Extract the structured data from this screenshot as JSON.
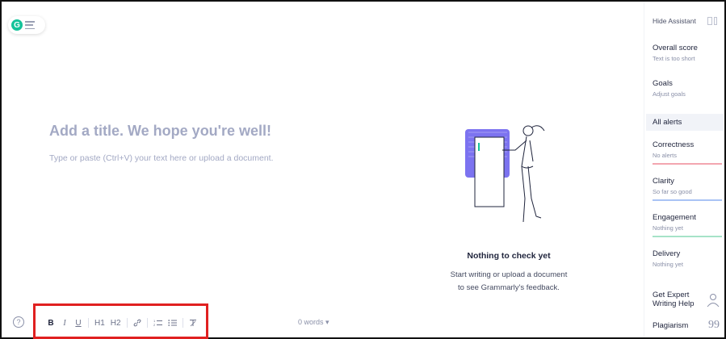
{
  "app": {
    "logo_letter": "G"
  },
  "editor": {
    "title_placeholder": "Add a title. We hope you're well!",
    "body_placeholder": "Type or paste (Ctrl+V) your text here or upload a document."
  },
  "empty_state": {
    "title": "Nothing to check yet",
    "text_line1": "Start writing or upload a document",
    "text_line2": "to see Grammarly's feedback."
  },
  "toolbar": {
    "help": "?",
    "bold": "B",
    "italic": "I",
    "underline": "U",
    "h1": "H1",
    "h2": "H2",
    "link": "🔗",
    "ordered_list": "⅟≡",
    "bullet_list": "☰",
    "clear": "T̸",
    "word_count": "0 words ▾"
  },
  "sidebar": {
    "hide_assistant": "Hide Assistant",
    "overall_score": {
      "label": "Overall score",
      "sub": "Text is too short"
    },
    "goals": {
      "label": "Goals",
      "sub": "Adjust goals"
    },
    "all_alerts": "All alerts",
    "categories": [
      {
        "label": "Correctness",
        "sub": "No alerts",
        "color": "#f3a6b0"
      },
      {
        "label": "Clarity",
        "sub": "So far so good",
        "color": "#a9c3f5"
      },
      {
        "label": "Engagement",
        "sub": "Nothing yet",
        "color": "#a6e3c8"
      },
      {
        "label": "Delivery",
        "sub": "Nothing yet",
        "color": "#d9c3f0"
      }
    ],
    "expert_line1": "Get Expert",
    "expert_line2": "Writing Help",
    "plagiarism": "Plagiarism"
  },
  "colors": {
    "brand": "#15c39a",
    "highlight_box": "#e02020",
    "illustration_purple": "#7c73f0"
  }
}
